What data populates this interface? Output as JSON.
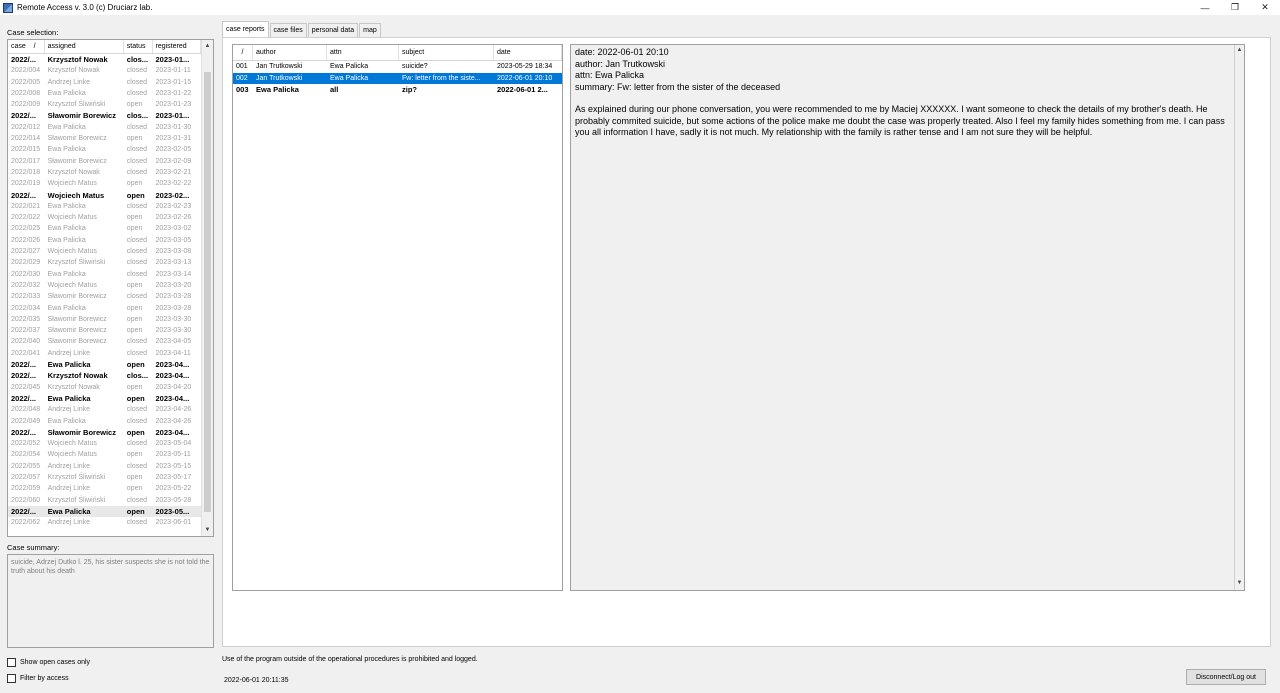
{
  "window": {
    "title": "Remote Access v. 3.0 (c) Druciarz lab.",
    "minimize": "—",
    "maximize": "❐",
    "close": "✕"
  },
  "left": {
    "case_selection_label": "Case selection:",
    "columns": [
      "case",
      "assigned",
      "status",
      "registered"
    ],
    "sort_glyph": "/",
    "scroll_up": "▲",
    "scroll_down": "▼",
    "cases": [
      {
        "case": "2022/...",
        "assigned": "Krzysztof Nowak",
        "status": "clos...",
        "registered": "2023-01...",
        "bold": true
      },
      {
        "case": "2022/004",
        "assigned": "Krzysztof Nowak",
        "status": "closed",
        "registered": "2023-01-11",
        "bold": false
      },
      {
        "case": "2022/005",
        "assigned": "Andrzej Linke",
        "status": "closed",
        "registered": "2023-01-15",
        "bold": false
      },
      {
        "case": "2022/008",
        "assigned": "Ewa Palicka",
        "status": "closed",
        "registered": "2023-01-22",
        "bold": false
      },
      {
        "case": "2022/009",
        "assigned": "Krzysztof Śliwiński",
        "status": "open",
        "registered": "2023-01-23",
        "bold": false
      },
      {
        "case": "2022/...",
        "assigned": "Sławomir Borewicz",
        "status": "clos...",
        "registered": "2023-01...",
        "bold": true
      },
      {
        "case": "2022/012",
        "assigned": "Ewa Palicka",
        "status": "closed",
        "registered": "2023-01-30",
        "bold": false
      },
      {
        "case": "2022/014",
        "assigned": "Sławomir Borewicz",
        "status": "open",
        "registered": "2023-01-31",
        "bold": false
      },
      {
        "case": "2022/015",
        "assigned": "Ewa Palicka",
        "status": "closed",
        "registered": "2023-02-05",
        "bold": false
      },
      {
        "case": "2022/017",
        "assigned": "Sławomir Borewicz",
        "status": "closed",
        "registered": "2023-02-09",
        "bold": false
      },
      {
        "case": "2022/018",
        "assigned": "Krzysztof Nowak",
        "status": "closed",
        "registered": "2023-02-21",
        "bold": false
      },
      {
        "case": "2022/019",
        "assigned": "Wojciech Matus",
        "status": "open",
        "registered": "2023-02-22",
        "bold": false
      },
      {
        "case": "2022/...",
        "assigned": "Wojciech Matus",
        "status": "open",
        "registered": "2023-02...",
        "bold": true
      },
      {
        "case": "2022/021",
        "assigned": "Ewa Palicka",
        "status": "closed",
        "registered": "2023-02-23",
        "bold": false
      },
      {
        "case": "2022/022",
        "assigned": "Wojciech Matus",
        "status": "open",
        "registered": "2023-02-26",
        "bold": false
      },
      {
        "case": "2022/025",
        "assigned": "Ewa Palicka",
        "status": "open",
        "registered": "2023-03-02",
        "bold": false
      },
      {
        "case": "2022/026",
        "assigned": "Ewa Palicka",
        "status": "closed",
        "registered": "2023-03-05",
        "bold": false
      },
      {
        "case": "2022/027",
        "assigned": "Wojciech Matus",
        "status": "closed",
        "registered": "2023-03-08",
        "bold": false
      },
      {
        "case": "2022/029",
        "assigned": "Krzysztof Śliwiński",
        "status": "closed",
        "registered": "2023-03-13",
        "bold": false
      },
      {
        "case": "2022/030",
        "assigned": "Ewa Palicka",
        "status": "closed",
        "registered": "2023-03-14",
        "bold": false
      },
      {
        "case": "2022/032",
        "assigned": "Wojciech Matus",
        "status": "open",
        "registered": "2023-03-20",
        "bold": false
      },
      {
        "case": "2022/033",
        "assigned": "Sławomir Borewicz",
        "status": "closed",
        "registered": "2023-03-28",
        "bold": false
      },
      {
        "case": "2022/034",
        "assigned": "Ewa Palicka",
        "status": "open",
        "registered": "2023-03-28",
        "bold": false
      },
      {
        "case": "2022/035",
        "assigned": "Sławomir Borewicz",
        "status": "open",
        "registered": "2023-03-30",
        "bold": false
      },
      {
        "case": "2022/037",
        "assigned": "Sławomir Borewicz",
        "status": "open",
        "registered": "2023-03-30",
        "bold": false
      },
      {
        "case": "2022/040",
        "assigned": "Sławomir Borewicz",
        "status": "closed",
        "registered": "2023-04-05",
        "bold": false
      },
      {
        "case": "2022/041",
        "assigned": "Andrzej Linke",
        "status": "closed",
        "registered": "2023-04-11",
        "bold": false
      },
      {
        "case": "2022/...",
        "assigned": "Ewa Palicka",
        "status": "open",
        "registered": "2023-04...",
        "bold": true
      },
      {
        "case": "2022/...",
        "assigned": "Krzysztof Nowak",
        "status": "clos...",
        "registered": "2023-04...",
        "bold": true
      },
      {
        "case": "2022/045",
        "assigned": "Krzysztof Nowak",
        "status": "open",
        "registered": "2023-04-20",
        "bold": false
      },
      {
        "case": "2022/...",
        "assigned": "Ewa Palicka",
        "status": "open",
        "registered": "2023-04...",
        "bold": true
      },
      {
        "case": "2022/048",
        "assigned": "Andrzej Linke",
        "status": "closed",
        "registered": "2023-04-26",
        "bold": false
      },
      {
        "case": "2022/049",
        "assigned": "Ewa Palicka",
        "status": "closed",
        "registered": "2023-04-26",
        "bold": false
      },
      {
        "case": "2022/...",
        "assigned": "Sławomir Borewicz",
        "status": "open",
        "registered": "2023-04...",
        "bold": true
      },
      {
        "case": "2022/052",
        "assigned": "Wojciech Matus",
        "status": "closed",
        "registered": "2023-05-04",
        "bold": false
      },
      {
        "case": "2022/054",
        "assigned": "Wojciech Matus",
        "status": "open",
        "registered": "2023-05-11",
        "bold": false
      },
      {
        "case": "2022/055",
        "assigned": "Andrzej Linke",
        "status": "closed",
        "registered": "2023-05-15",
        "bold": false
      },
      {
        "case": "2022/057",
        "assigned": "Krzysztof Śliwiński",
        "status": "open",
        "registered": "2023-05-17",
        "bold": false
      },
      {
        "case": "2022/059",
        "assigned": "Andrzej Linke",
        "status": "open",
        "registered": "2023-05-22",
        "bold": false
      },
      {
        "case": "2022/060",
        "assigned": "Krzysztof Śliwiński",
        "status": "closed",
        "registered": "2023-05-28",
        "bold": false
      },
      {
        "case": "2022/...",
        "assigned": "Ewa Palicka",
        "status": "open",
        "registered": "2023-05...",
        "bold": true,
        "selected": true
      },
      {
        "case": "2022/062",
        "assigned": "Andrzej Linke",
        "status": "closed",
        "registered": "2023-06-01",
        "bold": false
      }
    ],
    "case_summary_label": "Case summary:",
    "case_summary_text": "suicide, Adrzej Dutko l. 25, his sister suspects she is not told the truth about his death",
    "show_open_label": "Show open cases only",
    "filter_access_label": "Filter by access"
  },
  "tabs": [
    {
      "label": "case reports",
      "active": true
    },
    {
      "label": "case files",
      "active": false
    },
    {
      "label": "personal data",
      "active": false
    },
    {
      "label": "map",
      "active": false
    }
  ],
  "reports": {
    "columns": [
      "/",
      "author",
      "attn",
      "subject",
      "date"
    ],
    "rows": [
      {
        "num": "001",
        "author": "Jan Trutkowski",
        "attn": "Ewa Palicka",
        "subject": "suicide?",
        "date": "2023-05-29 18:34",
        "bold": false,
        "selected": false
      },
      {
        "num": "002",
        "author": "Jan Trutkowski",
        "attn": "Ewa Palicka",
        "subject": "Fw: letter from the siste...",
        "date": "2022-06-01 20:10",
        "bold": false,
        "selected": true
      },
      {
        "num": "003",
        "author": "Ewa Palicka",
        "attn": "all",
        "subject": "zip?",
        "date": "2022-06-01 2...",
        "bold": true,
        "selected": false
      }
    ]
  },
  "report_view": {
    "date_line": "date: 2022-06-01 20:10",
    "author_line": "author: Jan Trutkowski",
    "attn_line": "attn: Ewa Palicka",
    "summary_line": "summary: Fw: letter from the sister of the deceased",
    "body": "As explained during our phone conversation, you were recommended to me by Maciej XXXXXX. I want someone to check the details of my brother's death. He probably commited suicide, but some actions of the police make me doubt the case was properly treated. Also I feel my family hides something from me. I can pass you all information I have, sadly it is not much. My relationship with the family is rather tense and I am not sure they will be helpful.",
    "scroll_up": "▲",
    "scroll_down": "▼"
  },
  "footer": {
    "note": "Use of the program outside of the operational procedures is prohibited and logged.",
    "timestamp": "2022-06-01 20:11:35",
    "logout_label": "Disconnect/Log out"
  }
}
